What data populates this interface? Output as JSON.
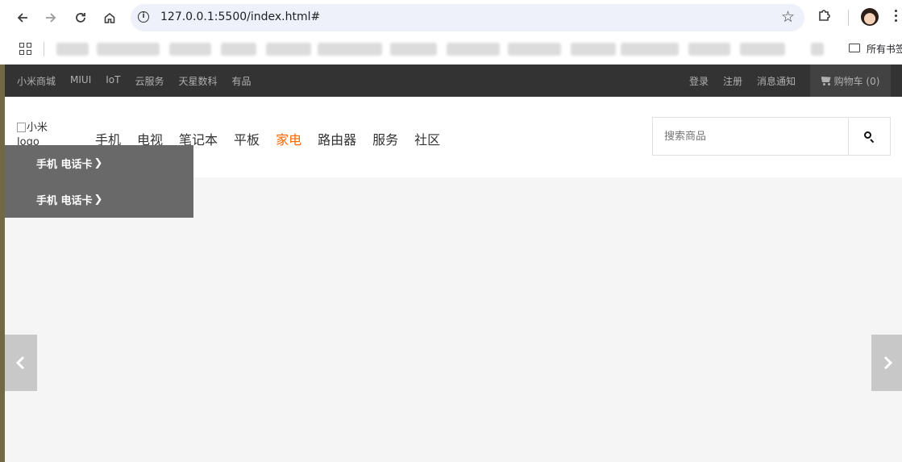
{
  "browser": {
    "url": "127.0.0.1:5500/index.html#",
    "bookmarks_all_label": "所有书签"
  },
  "topbar": {
    "left_links": [
      "小米商城",
      "MIUI",
      "IoT",
      "云服务",
      "天星数科",
      "有品"
    ],
    "right_links": [
      "登录",
      "注册",
      "消息通知"
    ],
    "cart_label": "购物车 (0)"
  },
  "header": {
    "logo_alt": "小米logo",
    "nav": [
      "手机",
      "电视",
      "笔记本",
      "平板",
      "家电",
      "路由器",
      "服务",
      "社区"
    ],
    "active_nav": "家电",
    "search_placeholder": "搜索商品"
  },
  "dropdown": {
    "items": [
      "手机 电话卡",
      "手机 电话卡"
    ]
  },
  "colors": {
    "accent": "#ff6700",
    "topbar_bg": "#333333",
    "dropdown_bg": "#696969"
  }
}
